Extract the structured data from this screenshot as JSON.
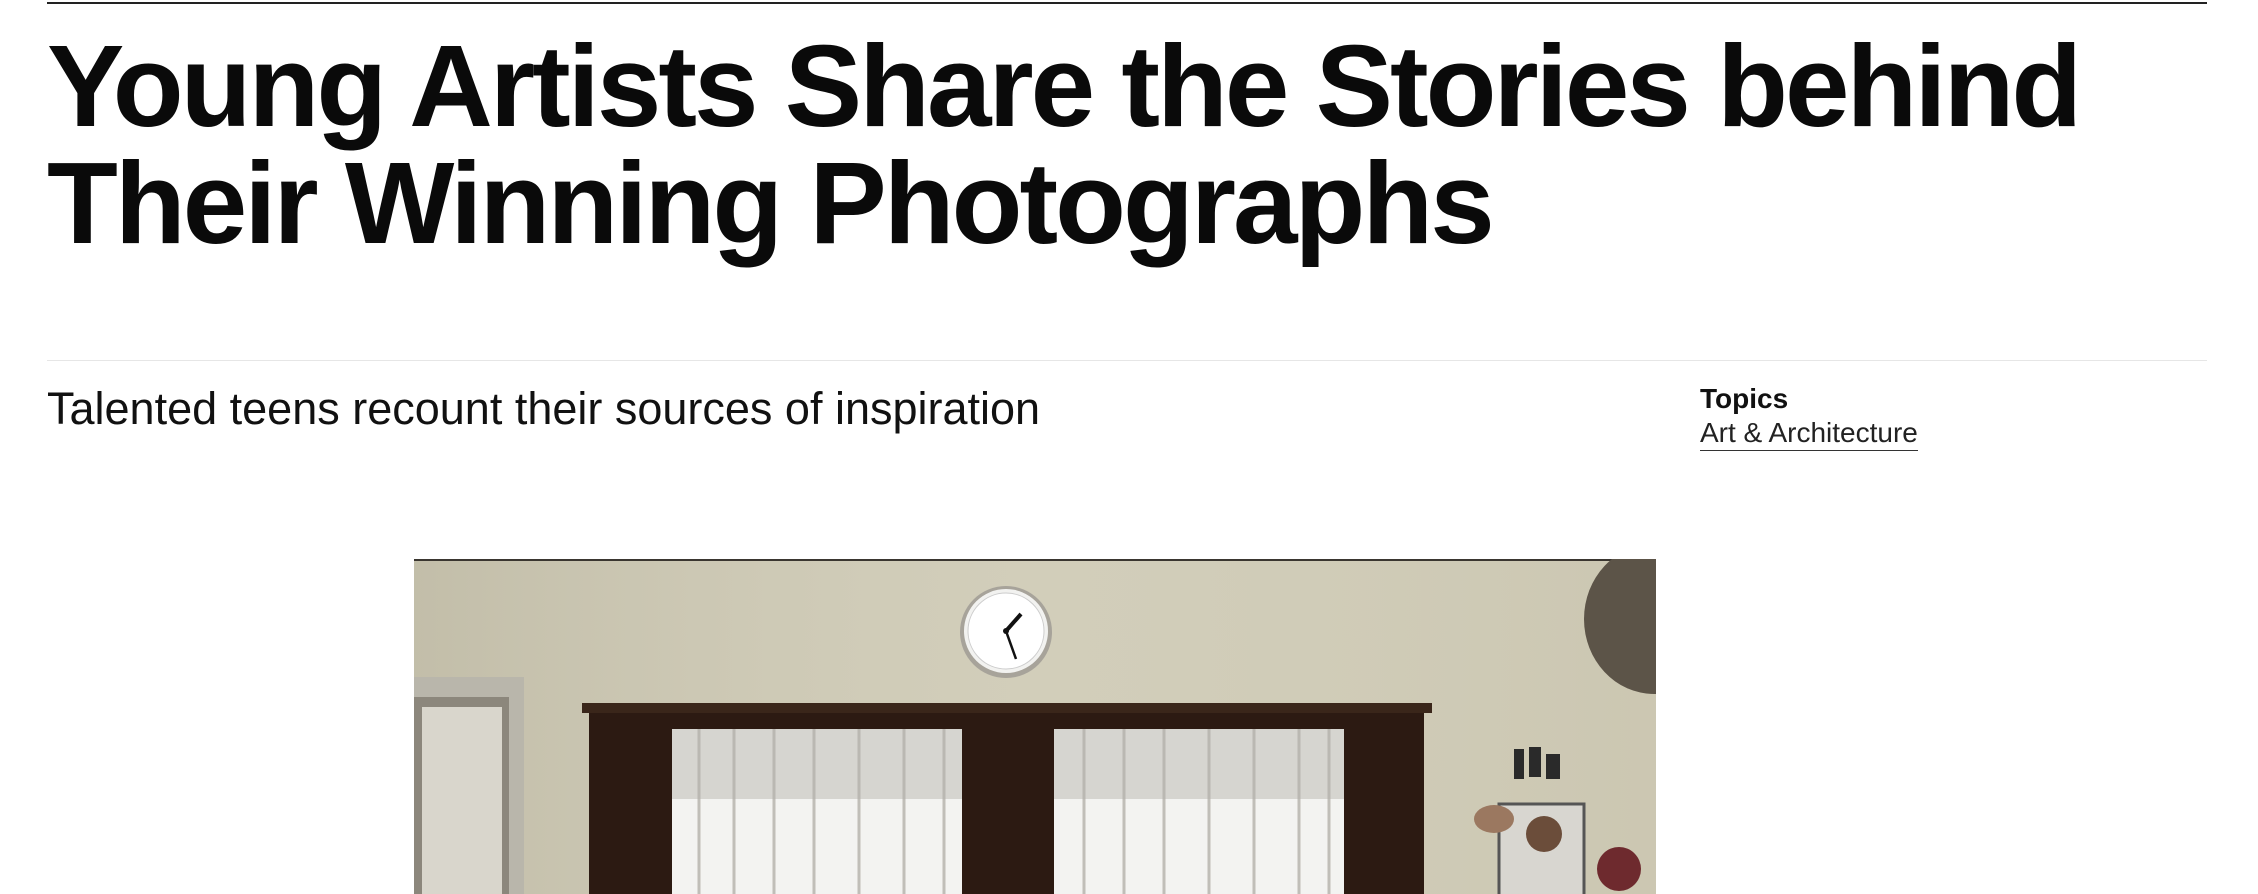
{
  "article": {
    "title": "Young Artists Share the Stories behind Their Winning Photographs",
    "dek": "Talented teens recount their sources of inspiration"
  },
  "topics": {
    "label": "Topics",
    "links": [
      "Art & Architecture"
    ]
  },
  "hero_image": {
    "subject": "room-with-clock-and-curtained-windows"
  }
}
